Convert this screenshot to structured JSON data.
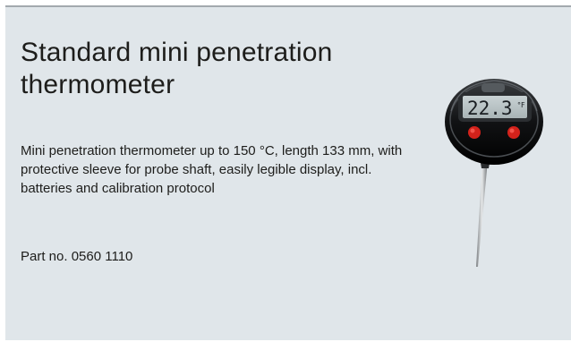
{
  "product": {
    "title": "Standard mini penetration thermometer",
    "description": "Mini penetration thermometer up to 150 °C, length 133 mm, with protective sleeve for probe shaft, easily legible display, incl. batteries and calibration protocol",
    "part_number": "Part no. 0560 1110",
    "display_reading": "22.3",
    "display_unit": "°F"
  }
}
